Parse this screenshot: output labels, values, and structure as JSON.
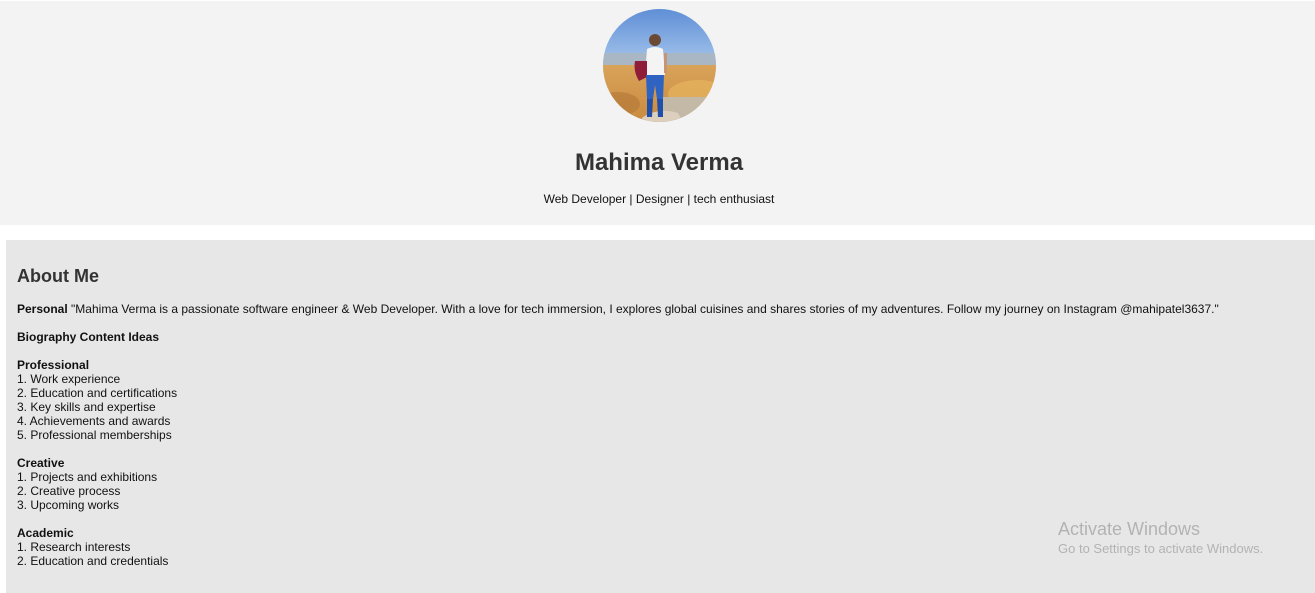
{
  "profile": {
    "name": "Mahima Verma",
    "tagline": "Web Developer | Designer | tech enthusiast",
    "photo_icon": "profile-photo"
  },
  "about": {
    "title": "About Me",
    "personal_label": "Personal",
    "personal_text": "\"Mahima Verma is a passionate software engineer & Web Developer. With a love for tech immersion, I explores global cuisines and shares stories of my adventures. Follow my journey on Instagram @mahipatel3637.\"",
    "bio_heading": "Biography Content Ideas",
    "sections": [
      {
        "heading": "Professional",
        "items": [
          "1. Work experience",
          "2. Education and certifications",
          "3. Key skills and expertise",
          "4. Achievements and awards",
          "5. Professional memberships"
        ]
      },
      {
        "heading": "Creative",
        "items": [
          "1. Projects and exhibitions",
          "2. Creative process",
          "3. Upcoming works"
        ]
      },
      {
        "heading": "Academic",
        "items": [
          "1. Research interests",
          "2. Education and credentials"
        ]
      }
    ]
  },
  "watermark": {
    "title": "Activate Windows",
    "subtitle": "Go to Settings to activate Windows."
  }
}
